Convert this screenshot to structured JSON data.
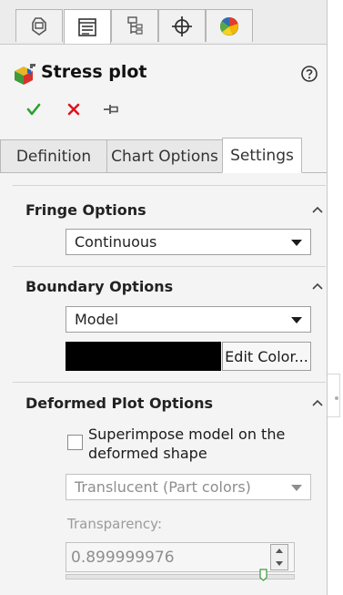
{
  "top_tabs": [
    {
      "icon": "feature-manager-icon",
      "active": false
    },
    {
      "icon": "property-manager-icon",
      "active": true
    },
    {
      "icon": "configuration-manager-icon",
      "active": false
    },
    {
      "icon": "dimxpert-manager-icon",
      "active": false
    },
    {
      "icon": "display-manager-icon",
      "active": false
    }
  ],
  "header": {
    "title": "Stress plot",
    "title_icon": "stress-plot-icon",
    "help_icon": "help-icon",
    "actions": [
      {
        "name": "ok",
        "icon": "checkmark-icon",
        "color": "#2ca02c"
      },
      {
        "name": "cancel",
        "icon": "close-icon",
        "color": "#e0141e"
      },
      {
        "name": "pin",
        "icon": "pushpin-icon",
        "color": "#555555"
      }
    ]
  },
  "property_tabs": {
    "items": [
      "Definition",
      "Chart Options",
      "Settings"
    ],
    "active": "Settings"
  },
  "fringe_options": {
    "title": "Fringe Options",
    "selected": "Continuous"
  },
  "boundary_options": {
    "title": "Boundary Options",
    "selected": "Model",
    "color_swatch": "#000000",
    "edit_color_label": "Edit Color..."
  },
  "deformed_plot_options": {
    "title": "Deformed Plot Options",
    "superimpose_label": "Superimpose model on the deformed shape",
    "superimpose_checked": false,
    "display_mode": "Translucent (Part colors)",
    "transparency_label": "Transparency:",
    "transparency_value": "0.899999976"
  },
  "colors": {
    "panel_bg": "#f4f4f4",
    "check_green": "#2ca02c",
    "cancel_red": "#e0141e"
  }
}
